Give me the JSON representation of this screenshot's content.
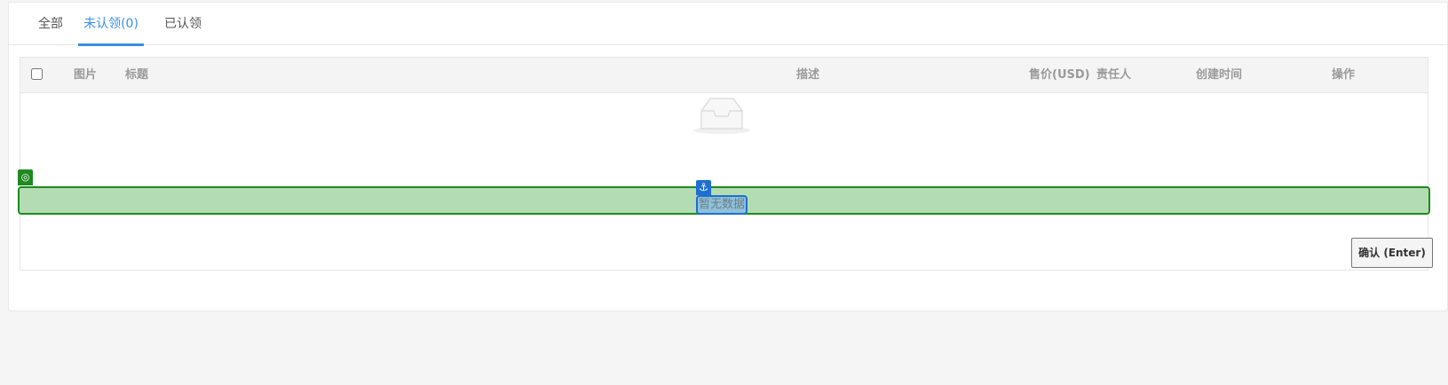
{
  "tabs": [
    {
      "label": "全部(0)",
      "active": false
    },
    {
      "label": "未认领(0)",
      "active": true
    },
    {
      "label": "已认领(0)",
      "active": false
    }
  ],
  "table": {
    "columns": [
      "图片",
      "标题",
      "描述",
      "售价(USD)",
      "责任人",
      "创建时间",
      "操作"
    ],
    "rows": [],
    "select_all_checked": false
  },
  "empty_state": {
    "text": "暂无数据",
    "icon": "empty-inbox-icon"
  },
  "overlay": {
    "target_marker_icon": "target-icon",
    "target_marker_glyph": "◎",
    "anchor_marker_icon": "anchor-icon",
    "anchor_marker_glyph": "⚓"
  },
  "footer": {
    "confirm_label": "确认 (Enter)"
  },
  "colors": {
    "accent": "#3a8ee6",
    "highlight_fill": "#b3dcb3",
    "highlight_border": "#1f8a1f",
    "anchor_blue": "#1f6fd0"
  }
}
